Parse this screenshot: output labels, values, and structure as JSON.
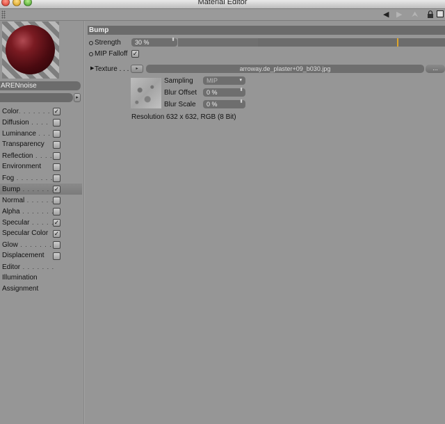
{
  "window": {
    "title": "Material Editor"
  },
  "toolbar": {
    "icons": [
      "grip-icon",
      "arrow-left-icon",
      "arrow-right-icon",
      "arrow-up-icon",
      "lock-icon",
      "new-window-icon"
    ],
    "arrow_left": "◀",
    "arrow_right": "▶",
    "arrow_up": "⮝"
  },
  "material": {
    "name": "ARENnoise",
    "field_button": "▸"
  },
  "channels": [
    {
      "label": "Color",
      "dots": ". . . . . . .",
      "checkbox": true,
      "checked": true,
      "selected": false
    },
    {
      "label": "Diffusion",
      "dots": " . . . .",
      "checkbox": true,
      "checked": false,
      "selected": false
    },
    {
      "label": "Luminance",
      "dots": " . . .",
      "checkbox": true,
      "checked": false,
      "selected": false
    },
    {
      "label": "Transparency",
      "dots": "",
      "checkbox": true,
      "checked": false,
      "selected": false
    },
    {
      "label": "Reflection",
      "dots": " . . . .",
      "checkbox": true,
      "checked": false,
      "selected": false
    },
    {
      "label": "Environment",
      "dots": "",
      "checkbox": true,
      "checked": false,
      "selected": false
    },
    {
      "label": "Fog",
      "dots": " . . . . . . . . .",
      "checkbox": true,
      "checked": false,
      "selected": false
    },
    {
      "label": "Bump",
      "dots": " . . . . . . .",
      "checkbox": true,
      "checked": true,
      "selected": true
    },
    {
      "label": "Normal",
      "dots": " . . . . . .",
      "checkbox": true,
      "checked": false,
      "selected": false
    },
    {
      "label": "Alpha",
      "dots": " . . . . . . .",
      "checkbox": true,
      "checked": false,
      "selected": false
    },
    {
      "label": "Specular",
      "dots": " . . . . .",
      "checkbox": true,
      "checked": true,
      "selected": false
    },
    {
      "label": "Specular Color",
      "dots": "",
      "checkbox": true,
      "checked": true,
      "selected": false
    },
    {
      "label": "Glow",
      "dots": " . . . . . . . .",
      "checkbox": true,
      "checked": false,
      "selected": false
    },
    {
      "label": "Displacement",
      "dots": "",
      "checkbox": true,
      "checked": false,
      "selected": false
    },
    {
      "label": "Editor",
      "dots": " . . . . . . .",
      "checkbox": false,
      "checked": false,
      "selected": false
    },
    {
      "label": "Illumination",
      "dots": "",
      "checkbox": false,
      "checked": false,
      "selected": false
    },
    {
      "label": "Assignment",
      "dots": "",
      "checkbox": false,
      "checked": false,
      "selected": false
    }
  ],
  "bump": {
    "header": "Bump",
    "strength_label": "Strength",
    "strength_value": "30 %",
    "strength_fraction": 0.3,
    "mip_falloff_label": "MIP Falloff",
    "mip_falloff_checked": true,
    "texture_label": "Texture . . .",
    "texture_button": "▸",
    "texture_file": "arroway.de_plaster+09_b030.jpg",
    "texture_more": "...",
    "sampling_label": "Sampling",
    "sampling_value": "MIP",
    "blur_offset_label": "Blur Offset",
    "blur_offset_value": "0 %",
    "blur_scale_label": "Blur Scale",
    "blur_scale_value": "0 %",
    "resolution": "Resolution 632 x 632, RGB (8 Bit)"
  },
  "colors": {
    "background": "#959595",
    "header": "#6b6b6b",
    "field": "#6e6e6e",
    "slider_marker": "#e0a62a",
    "sphere": "#7a1b22"
  },
  "checkmark": "✓",
  "spin_glyph": "⬍",
  "dropdown_glyph": "▾"
}
